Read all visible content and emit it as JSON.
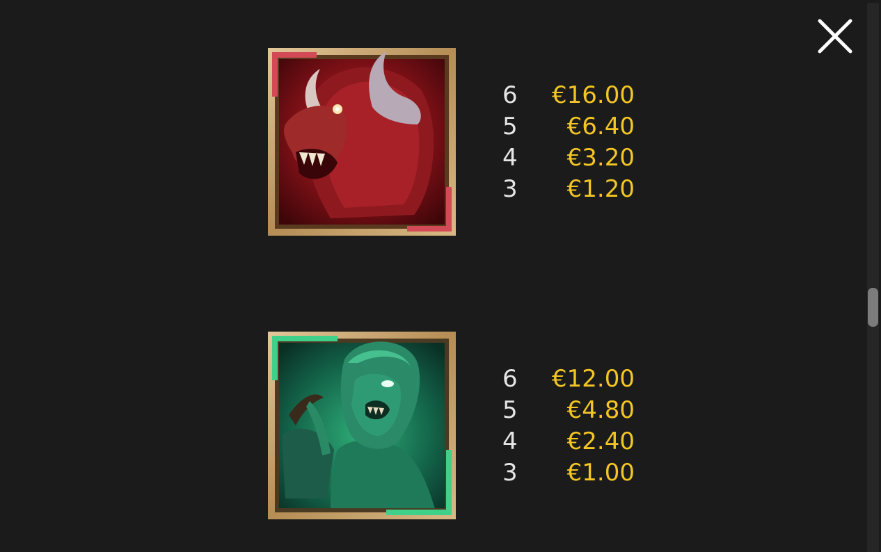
{
  "close_icon": "close-icon",
  "colors": {
    "background": "#1b1b1b",
    "count_text": "#e6e6e6",
    "payout_text": "#f3c623",
    "frame_gold": "#c8a570",
    "red_accent": "#d24a55",
    "green_accent": "#3fd18a"
  },
  "symbols": [
    {
      "image": "red-horned-beast-symbol",
      "payouts": [
        {
          "count": "6",
          "value": "€16.00"
        },
        {
          "count": "5",
          "value": "€6.40"
        },
        {
          "count": "4",
          "value": "€3.20"
        },
        {
          "count": "3",
          "value": "€1.20"
        }
      ]
    },
    {
      "image": "green-medusa-symbol",
      "payouts": [
        {
          "count": "6",
          "value": "€12.00"
        },
        {
          "count": "5",
          "value": "€4.80"
        },
        {
          "count": "4",
          "value": "€2.40"
        },
        {
          "count": "3",
          "value": "€1.00"
        }
      ]
    }
  ]
}
